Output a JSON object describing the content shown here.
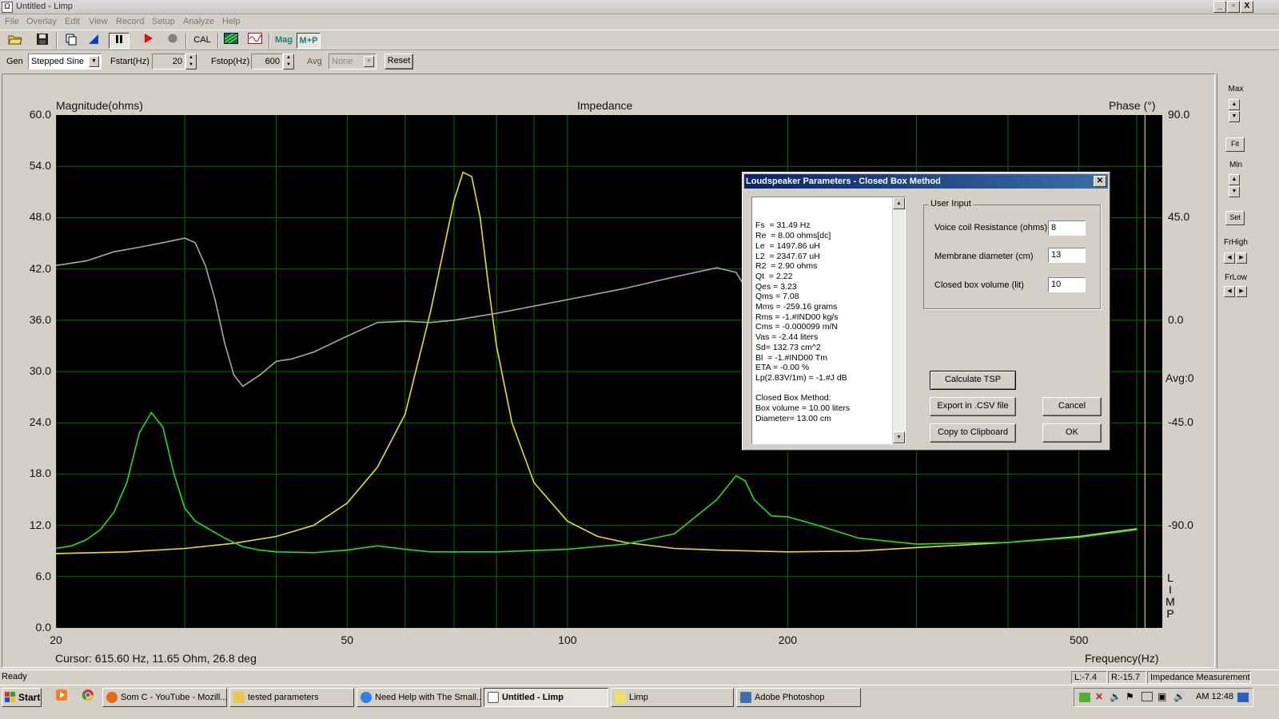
{
  "window": {
    "title": "Untitled - Limp",
    "min": "_",
    "max": "▫",
    "close": "X"
  },
  "menu": [
    "File",
    "Overlay",
    "Edit",
    "View",
    "Record",
    "Setup",
    "Analyze",
    "Help"
  ],
  "toolbar": {
    "cal": "CAL",
    "mag": "Mag",
    "mp": "M+P"
  },
  "gen": {
    "gen_label": "Gen",
    "gen_value": "Stepped Sine",
    "fstart_label": "Fstart(Hz)",
    "fstart_value": "20",
    "fstop_label": "Fstop(Hz)",
    "fstop_value": "600",
    "avg_label": "Avg",
    "avg_value": "None",
    "reset": "Reset"
  },
  "plot": {
    "left_title": "Magnitude(ohms)",
    "center_title": "Impedance",
    "right_title": "Phase (°)",
    "y_ticks": [
      "60.0",
      "54.0",
      "48.0",
      "42.0",
      "36.0",
      "30.0",
      "24.0",
      "18.0",
      "12.0",
      "6.0",
      "0.0"
    ],
    "phase_ticks": [
      "90.0",
      "45.0",
      "0.0",
      "-45.0",
      "-90.0"
    ],
    "avg_label": "Avg:0",
    "x_ticks": [
      "20",
      "50",
      "100",
      "200",
      "500"
    ],
    "x_label": "Frequency(Hz)",
    "cursor": "Cursor: 615.60 Hz, 11.65 Ohm, 26.8 deg",
    "logo": [
      "L",
      "I",
      "M",
      "P"
    ]
  },
  "chart_data": {
    "type": "line",
    "xscale": "log",
    "xlim": [
      20,
      650
    ],
    "ylim": [
      0,
      60
    ],
    "y2lim": [
      -135,
      90
    ],
    "xlabel": "Frequency(Hz)",
    "ylabel": "Magnitude(ohms)",
    "y2label": "Phase (°)",
    "title": "Impedance",
    "grid": true,
    "series": [
      {
        "color": "#e6e02a",
        "axis": "magnitude",
        "x": [
          20,
          25,
          30,
          35,
          40,
          45,
          50,
          55,
          60,
          65,
          70,
          72,
          74,
          76,
          78,
          80,
          84,
          90,
          100,
          110,
          120,
          140,
          160,
          200,
          250,
          300,
          400,
          500,
          600
        ],
        "y": [
          8.7,
          8.9,
          9.3,
          9.9,
          10.7,
          12,
          14.6,
          18.8,
          25,
          37,
          50,
          53.3,
          52.8,
          48,
          40,
          33,
          24,
          17,
          12.5,
          10.7,
          10,
          9.3,
          9.1,
          8.9,
          9,
          9.4,
          10,
          10.7,
          11.6
        ]
      },
      {
        "color": "#22dd22",
        "axis": "magnitude",
        "x": [
          20,
          21,
          22,
          23,
          24,
          25,
          26,
          27,
          28,
          29,
          30,
          31,
          32,
          34,
          36,
          38,
          40,
          45,
          50,
          55,
          60,
          65,
          70,
          80,
          100,
          120,
          140,
          160,
          170,
          175,
          180,
          190,
          200,
          220,
          250,
          300,
          400,
          500,
          600
        ],
        "y": [
          9.3,
          9.6,
          10.3,
          11.5,
          13.5,
          17,
          22.8,
          25.2,
          23.5,
          18,
          14,
          12.5,
          11.8,
          10.5,
          9.5,
          9.1,
          8.9,
          8.8,
          9.1,
          9.6,
          9.2,
          8.9,
          8.9,
          8.9,
          9.2,
          9.8,
          11,
          15,
          17.8,
          17.2,
          15,
          13.1,
          13,
          12,
          10.5,
          9.8,
          10,
          10.6,
          11.5
        ]
      },
      {
        "color": "#a8a8a8",
        "axis": "phase",
        "x": [
          20,
          22,
          24,
          26,
          28,
          30,
          31,
          32,
          33,
          34,
          35,
          36,
          38,
          40,
          42,
          45,
          50,
          55,
          60,
          65,
          70,
          80,
          100,
          120,
          140,
          160,
          170,
          180,
          190,
          200
        ],
        "y": [
          24,
          26,
          30,
          32,
          34,
          36,
          34,
          24,
          9,
          -10,
          -24,
          -29,
          -24,
          -18,
          -17,
          -14,
          -7,
          -1,
          -0.5,
          -1,
          0,
          3,
          9,
          14,
          19,
          23,
          21,
          8,
          0,
          -2
        ]
      }
    ]
  },
  "rightpanel": {
    "max": "Max",
    "fit": "Fit",
    "min": "Min",
    "set": "Set",
    "frhigh": "FrHigh",
    "frlow": "FrLow"
  },
  "dialog": {
    "title": "Loudspeaker Parameters - Closed Box Method",
    "results": [
      "Fs  = 31.49 Hz",
      "Re  = 8.00 ohms[dc]",
      "Le  = 1497.86 uH",
      "L2  = 2347.67 uH",
      "R2  = 2.90 ohms",
      "Qt  = 2.22",
      "Qes = 3.23",
      "Qms = 7.08",
      "Mms = -259.16 grams",
      "Rms = -1.#IND00 kg/s",
      "Cms = -0.000099 m/N",
      "Vas = -2.44 liters",
      "Sd= 132.73 cm^2",
      "Bl  = -1.#IND00 Tm",
      "ETA = -0.00 %",
      "Lp(2.83V/1m) = -1.#J dB",
      "",
      "Closed Box Method:",
      "Box volume = 10.00 liters",
      "Diameter= 13.00 cm"
    ],
    "user_input_legend": "User Input",
    "vc_label": "Voice coil Resistance (ohms)",
    "vc_value": "8",
    "md_label": "Membrane diameter (cm)",
    "md_value": "13",
    "cb_label": "Closed box volume (lit)",
    "cb_value": "10",
    "calc": "Calculate TSP",
    "export": "Export in .CSV file",
    "cancel": "Cancel",
    "copy": "Copy to Clipboard",
    "ok": "OK"
  },
  "status": {
    "ready": "Ready",
    "l": "L:-7.4",
    "r": "R:-15.7",
    "mode": "Impedance Measurement"
  },
  "taskbar": {
    "start": "Start",
    "tasks": [
      "Som C - YouTube - Mozill...",
      "tested parameters",
      "Need Help with The Small...",
      "Untitled - Limp",
      "Limp",
      "Adobe Photoshop"
    ],
    "clock": "AM 12:48"
  }
}
